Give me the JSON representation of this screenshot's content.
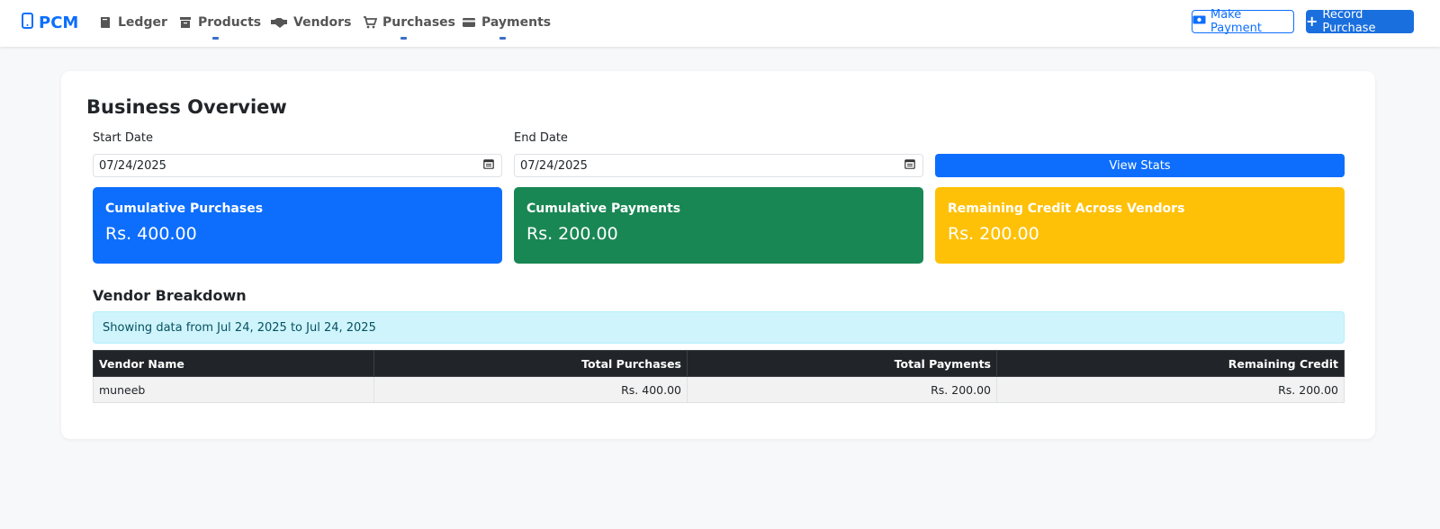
{
  "nav": {
    "brand": "PCM",
    "items": [
      {
        "label": "Ledger",
        "icon": "book-icon"
      },
      {
        "label": "Products",
        "icon": "box-icon"
      },
      {
        "label": "Vendors",
        "icon": "handshake-icon"
      },
      {
        "label": "Purchases",
        "icon": "cart-icon"
      },
      {
        "label": "Payments",
        "icon": "credit-card-icon"
      }
    ],
    "make_payment": "Make Payment",
    "record_purchase": "Record Purchase"
  },
  "page": {
    "title": "Business Overview",
    "start_label": "Start Date",
    "end_label": "End Date",
    "start_value": "07/24/2025",
    "end_value": "07/24/2025",
    "view_stats": "View Stats"
  },
  "stats": [
    {
      "title": "Cumulative Purchases",
      "value": "Rs. 400.00",
      "color": "#0d6efd"
    },
    {
      "title": "Cumulative Payments",
      "value": "Rs. 200.00",
      "color": "#198754"
    },
    {
      "title": "Remaining Credit Across Vendors",
      "value": "Rs. 200.00",
      "color": "#ffc107"
    }
  ],
  "breakdown": {
    "title": "Vendor Breakdown",
    "info": "Showing data from Jul 24, 2025 to Jul 24, 2025",
    "columns": [
      "Vendor Name",
      "Total Purchases",
      "Total Payments",
      "Remaining Credit"
    ],
    "rows": [
      [
        "muneeb",
        "Rs. 400.00",
        "Rs. 200.00",
        "Rs. 200.00"
      ]
    ]
  }
}
